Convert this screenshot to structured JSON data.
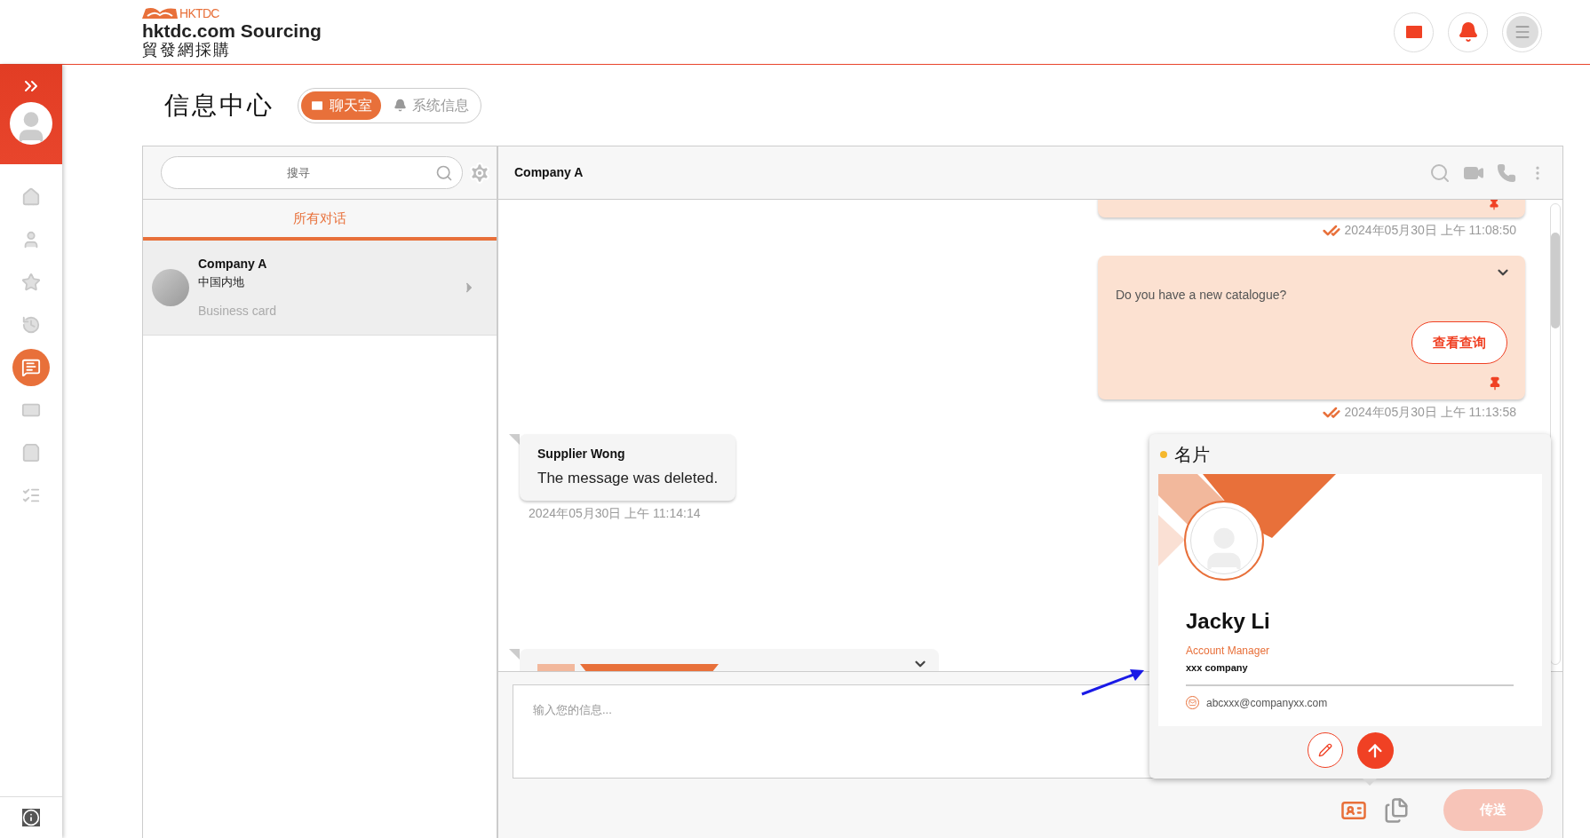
{
  "header": {
    "logo": {
      "brand": "HKTDC",
      "title": "hktdc.com Sourcing",
      "subtitle": "貿發網採購"
    }
  },
  "sidebar": {
    "items": [
      {
        "selected": false
      },
      {
        "selected": false
      },
      {
        "selected": false
      },
      {
        "selected": false
      },
      {
        "selected": true
      },
      {
        "selected": false
      },
      {
        "selected": false
      },
      {
        "selected": false
      }
    ]
  },
  "page": {
    "title": "信息中心",
    "tabs": [
      {
        "label": "聊天室",
        "selected": true
      },
      {
        "label": "系统信息",
        "selected": false
      }
    ]
  },
  "conversation_list": {
    "search": {
      "placeholder": "搜寻"
    },
    "filter_tab": {
      "label": "所有对话",
      "selected": true
    },
    "items": [
      {
        "name": "Company A",
        "region": "中国内地",
        "preview": "Business card",
        "selected": true
      }
    ]
  },
  "chat": {
    "title": "Company A",
    "messages": [
      {
        "kind": "outgoing",
        "pinned": true,
        "read": true,
        "time": "2024年05月30日 上午 11:08:50"
      },
      {
        "kind": "outgoing",
        "text": "Do you have a new catalogue?",
        "button": "查看查询",
        "pinned": true,
        "read": true,
        "time": "2024年05月30日 上午 11:13:58"
      },
      {
        "kind": "incoming",
        "sender": "Supplier Wong",
        "text": "The message was deleted.",
        "time": "2024年05月30日 上午 11:14:14"
      },
      {
        "kind": "incoming_card"
      }
    ],
    "input": {
      "placeholder": "输入您的信息..."
    },
    "send_button": "传送"
  },
  "business_card_popup": {
    "title": "名片",
    "name": "Jacky Li",
    "job_title": "Account Manager",
    "company": "xxx company",
    "email": "abcxxx@companyxx.com"
  }
}
